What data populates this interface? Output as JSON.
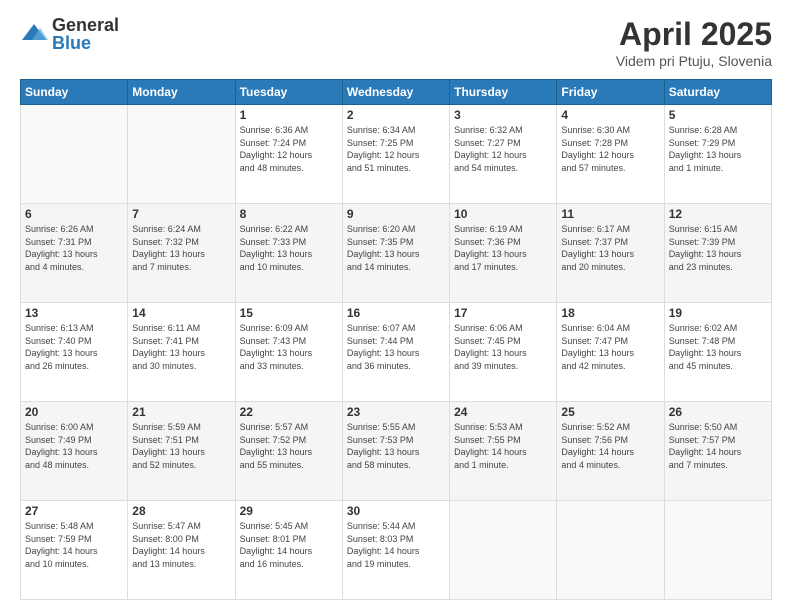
{
  "logo": {
    "general": "General",
    "blue": "Blue"
  },
  "title": {
    "month": "April 2025",
    "location": "Videm pri Ptuju, Slovenia"
  },
  "header_days": [
    "Sunday",
    "Monday",
    "Tuesday",
    "Wednesday",
    "Thursday",
    "Friday",
    "Saturday"
  ],
  "weeks": [
    [
      {
        "day": "",
        "info": ""
      },
      {
        "day": "",
        "info": ""
      },
      {
        "day": "1",
        "info": "Sunrise: 6:36 AM\nSunset: 7:24 PM\nDaylight: 12 hours\nand 48 minutes."
      },
      {
        "day": "2",
        "info": "Sunrise: 6:34 AM\nSunset: 7:25 PM\nDaylight: 12 hours\nand 51 minutes."
      },
      {
        "day": "3",
        "info": "Sunrise: 6:32 AM\nSunset: 7:27 PM\nDaylight: 12 hours\nand 54 minutes."
      },
      {
        "day": "4",
        "info": "Sunrise: 6:30 AM\nSunset: 7:28 PM\nDaylight: 12 hours\nand 57 minutes."
      },
      {
        "day": "5",
        "info": "Sunrise: 6:28 AM\nSunset: 7:29 PM\nDaylight: 13 hours\nand 1 minute."
      }
    ],
    [
      {
        "day": "6",
        "info": "Sunrise: 6:26 AM\nSunset: 7:31 PM\nDaylight: 13 hours\nand 4 minutes."
      },
      {
        "day": "7",
        "info": "Sunrise: 6:24 AM\nSunset: 7:32 PM\nDaylight: 13 hours\nand 7 minutes."
      },
      {
        "day": "8",
        "info": "Sunrise: 6:22 AM\nSunset: 7:33 PM\nDaylight: 13 hours\nand 10 minutes."
      },
      {
        "day": "9",
        "info": "Sunrise: 6:20 AM\nSunset: 7:35 PM\nDaylight: 13 hours\nand 14 minutes."
      },
      {
        "day": "10",
        "info": "Sunrise: 6:19 AM\nSunset: 7:36 PM\nDaylight: 13 hours\nand 17 minutes."
      },
      {
        "day": "11",
        "info": "Sunrise: 6:17 AM\nSunset: 7:37 PM\nDaylight: 13 hours\nand 20 minutes."
      },
      {
        "day": "12",
        "info": "Sunrise: 6:15 AM\nSunset: 7:39 PM\nDaylight: 13 hours\nand 23 minutes."
      }
    ],
    [
      {
        "day": "13",
        "info": "Sunrise: 6:13 AM\nSunset: 7:40 PM\nDaylight: 13 hours\nand 26 minutes."
      },
      {
        "day": "14",
        "info": "Sunrise: 6:11 AM\nSunset: 7:41 PM\nDaylight: 13 hours\nand 30 minutes."
      },
      {
        "day": "15",
        "info": "Sunrise: 6:09 AM\nSunset: 7:43 PM\nDaylight: 13 hours\nand 33 minutes."
      },
      {
        "day": "16",
        "info": "Sunrise: 6:07 AM\nSunset: 7:44 PM\nDaylight: 13 hours\nand 36 minutes."
      },
      {
        "day": "17",
        "info": "Sunrise: 6:06 AM\nSunset: 7:45 PM\nDaylight: 13 hours\nand 39 minutes."
      },
      {
        "day": "18",
        "info": "Sunrise: 6:04 AM\nSunset: 7:47 PM\nDaylight: 13 hours\nand 42 minutes."
      },
      {
        "day": "19",
        "info": "Sunrise: 6:02 AM\nSunset: 7:48 PM\nDaylight: 13 hours\nand 45 minutes."
      }
    ],
    [
      {
        "day": "20",
        "info": "Sunrise: 6:00 AM\nSunset: 7:49 PM\nDaylight: 13 hours\nand 48 minutes."
      },
      {
        "day": "21",
        "info": "Sunrise: 5:59 AM\nSunset: 7:51 PM\nDaylight: 13 hours\nand 52 minutes."
      },
      {
        "day": "22",
        "info": "Sunrise: 5:57 AM\nSunset: 7:52 PM\nDaylight: 13 hours\nand 55 minutes."
      },
      {
        "day": "23",
        "info": "Sunrise: 5:55 AM\nSunset: 7:53 PM\nDaylight: 13 hours\nand 58 minutes."
      },
      {
        "day": "24",
        "info": "Sunrise: 5:53 AM\nSunset: 7:55 PM\nDaylight: 14 hours\nand 1 minute."
      },
      {
        "day": "25",
        "info": "Sunrise: 5:52 AM\nSunset: 7:56 PM\nDaylight: 14 hours\nand 4 minutes."
      },
      {
        "day": "26",
        "info": "Sunrise: 5:50 AM\nSunset: 7:57 PM\nDaylight: 14 hours\nand 7 minutes."
      }
    ],
    [
      {
        "day": "27",
        "info": "Sunrise: 5:48 AM\nSunset: 7:59 PM\nDaylight: 14 hours\nand 10 minutes."
      },
      {
        "day": "28",
        "info": "Sunrise: 5:47 AM\nSunset: 8:00 PM\nDaylight: 14 hours\nand 13 minutes."
      },
      {
        "day": "29",
        "info": "Sunrise: 5:45 AM\nSunset: 8:01 PM\nDaylight: 14 hours\nand 16 minutes."
      },
      {
        "day": "30",
        "info": "Sunrise: 5:44 AM\nSunset: 8:03 PM\nDaylight: 14 hours\nand 19 minutes."
      },
      {
        "day": "",
        "info": ""
      },
      {
        "day": "",
        "info": ""
      },
      {
        "day": "",
        "info": ""
      }
    ]
  ]
}
